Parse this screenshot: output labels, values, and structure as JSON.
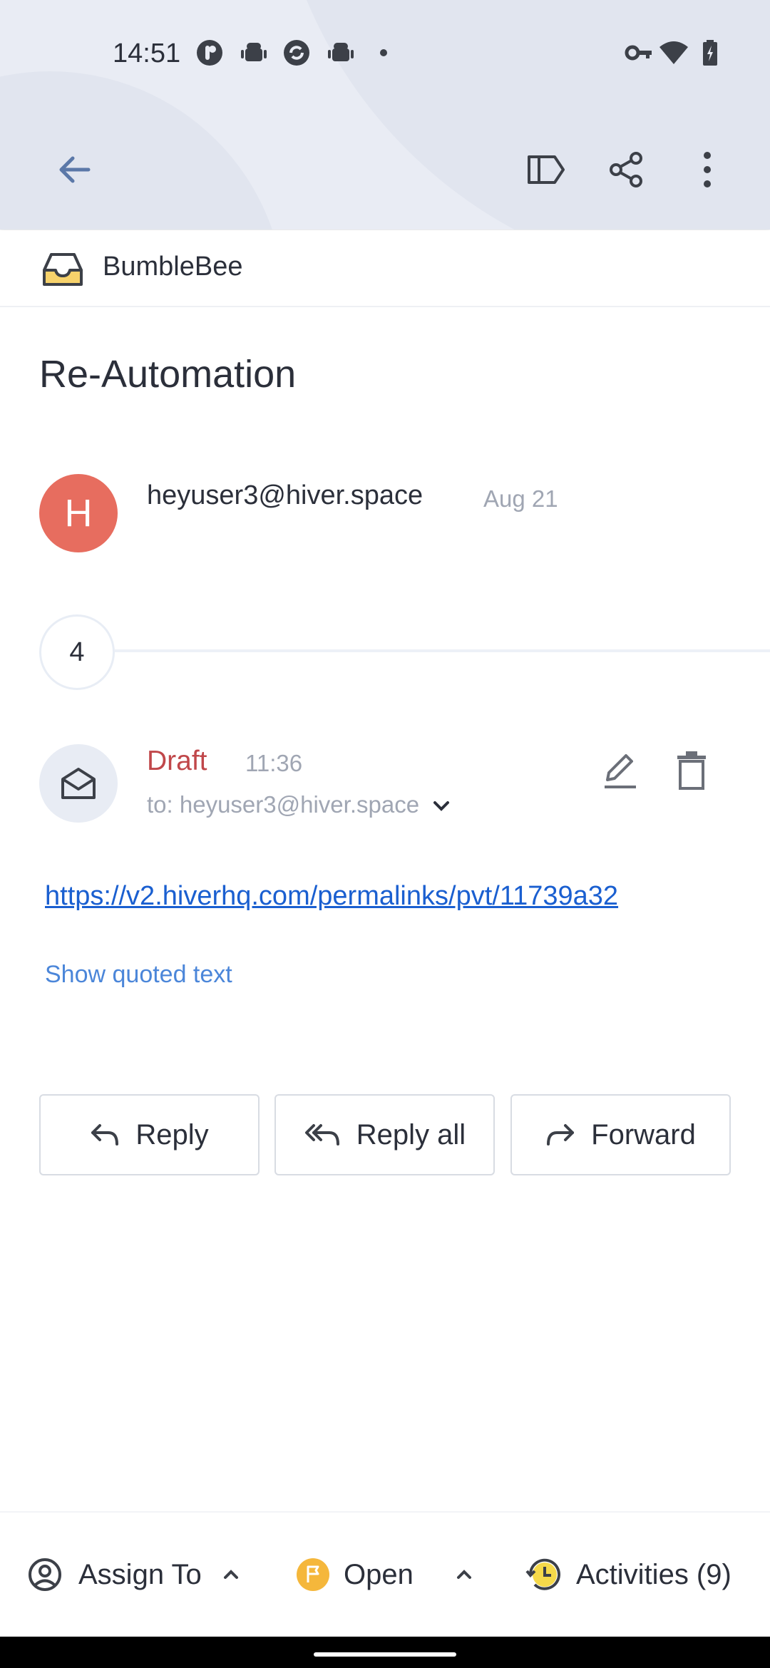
{
  "status_bar": {
    "time": "14:51"
  },
  "inbox": {
    "name": "BumbleBee"
  },
  "email": {
    "subject": "Re-Automation",
    "avatar_letter": "H",
    "sender": "heyuser3@hiver.space",
    "date": "Aug 21",
    "collapsed_count": "4"
  },
  "draft": {
    "label": "Draft",
    "time": "11:36",
    "to": "to: heyuser3@hiver.space",
    "link": "https://v2.hiverhq.com/permalinks/pvt/11739a32",
    "show_quoted": "Show quoted text"
  },
  "actions": {
    "reply": "Reply",
    "reply_all": "Reply all",
    "forward": "Forward"
  },
  "bottom_bar": {
    "assign": "Assign To",
    "status": "Open",
    "activities": "Activities (9)"
  },
  "colors": {
    "draft": "#c0474a",
    "link": "#1a5fd0",
    "avatar": "#e76d5f",
    "open_status": "#f5b73b"
  }
}
